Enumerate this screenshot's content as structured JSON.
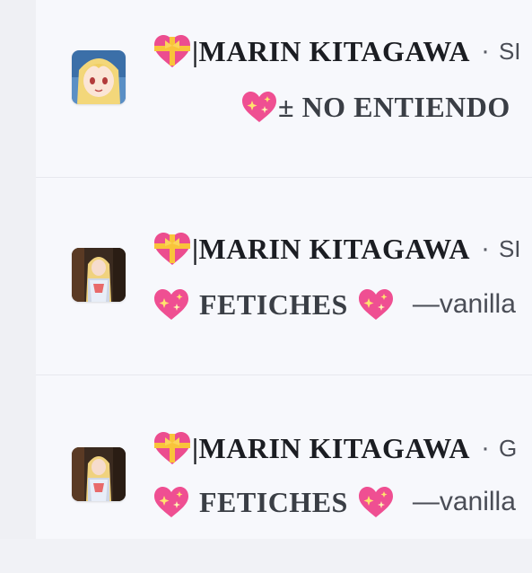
{
  "colors": {
    "background": "#f7f8fc",
    "author_text": "#1b1d22",
    "body_text": "#3a3e45",
    "heart_pink": "#ec4d8f",
    "ribbon_yellow": "#f9c43a"
  },
  "posts": [
    {
      "author": "|MARIN KITAGAWA",
      "dot": "·",
      "meta": "SI",
      "body_prefix": "± NO ENTIENDO",
      "body_suffix": ""
    },
    {
      "author": "|MARIN KITAGAWA",
      "dot": "·",
      "meta": "SI",
      "body_prefix": "FETICHES",
      "body_suffix": "—vanilla"
    },
    {
      "author": "|MARIN KITAGAWA",
      "dot": "·",
      "meta": "G",
      "body_prefix": "FETICHES",
      "body_suffix": "—vanilla"
    }
  ]
}
